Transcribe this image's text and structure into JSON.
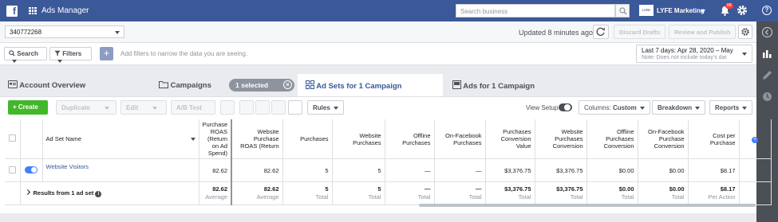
{
  "topbar": {
    "logo": "f",
    "app_title": "Ads Manager",
    "search_placeholder": "Search business",
    "account_logo_text": "LYFE",
    "account_name": "LYFE Marketing",
    "notification_count": "99",
    "help": "?"
  },
  "toolbar": {
    "account_id": "340772268",
    "updated": "Updated 8 minutes ago",
    "discard": "Discard Drafts",
    "review": "Review and Publish"
  },
  "filterbar": {
    "search": "Search",
    "filters": "Filters",
    "hint": "Add filters to narrow the data you are seeing.",
    "date_range": "Last 7 days: Apr 28, 2020 – May",
    "date_note": "Note: Does not include today's dat"
  },
  "tabs": [
    {
      "label": "Account Overview"
    },
    {
      "label": "Campaigns"
    },
    {
      "label": "Ad Sets for 1 Campaign"
    },
    {
      "label": "Ads for 1 Campaign"
    }
  ],
  "selection": {
    "label": "1 selected",
    "clear": "×"
  },
  "actions": {
    "create": "Create",
    "duplicate": "Duplicate",
    "edit": "Edit",
    "ab_test": "A/B Test",
    "rules": "Rules",
    "view_setup": "View Setup",
    "columns_prefix": "Columns: ",
    "columns_value": "Custom",
    "breakdown": "Breakdown",
    "reports": "Reports"
  },
  "table": {
    "headers": [
      "Ad Set Name",
      "Purchase ROAS (Return on Ad Spend)",
      "Website Purchase ROAS (Return",
      "Purchases",
      "Website Purchases",
      "Offline Purchases",
      "On-Facebook Purchases",
      "Purchases Conversion Value",
      "Website Purchases Conversion",
      "Offline Purchases Conversion",
      "On-Facebook Purchase Conversion",
      "Cost per Purchase"
    ],
    "rows": [
      {
        "name": "Website Visitors",
        "cells": [
          "82.62",
          "82.62",
          "5",
          "5",
          "—",
          "—",
          "$3,376.75",
          "$3,376.75",
          "$0.00",
          "$0.00",
          "$8.17"
        ]
      }
    ],
    "totals": {
      "label": "Results from 1 ad set",
      "cells": [
        {
          "value": "82.62",
          "sub": "Average"
        },
        {
          "value": "82.62",
          "sub": "Average"
        },
        {
          "value": "5",
          "sub": "Total"
        },
        {
          "value": "5",
          "sub": "Total"
        },
        {
          "value": "—",
          "sub": "Total"
        },
        {
          "value": "—",
          "sub": "Total"
        },
        {
          "value": "$3,376.75",
          "sub": "Total"
        },
        {
          "value": "$3,376.75",
          "sub": "Total"
        },
        {
          "value": "$0.00",
          "sub": "Total"
        },
        {
          "value": "$0.00",
          "sub": "Total"
        },
        {
          "value": "$8.17",
          "sub": "Per Action"
        }
      ]
    }
  },
  "colors": {
    "brand": "#3b5998",
    "create_green": "#42b72a",
    "link": "#365899",
    "toggle_on": "#4080ff"
  }
}
